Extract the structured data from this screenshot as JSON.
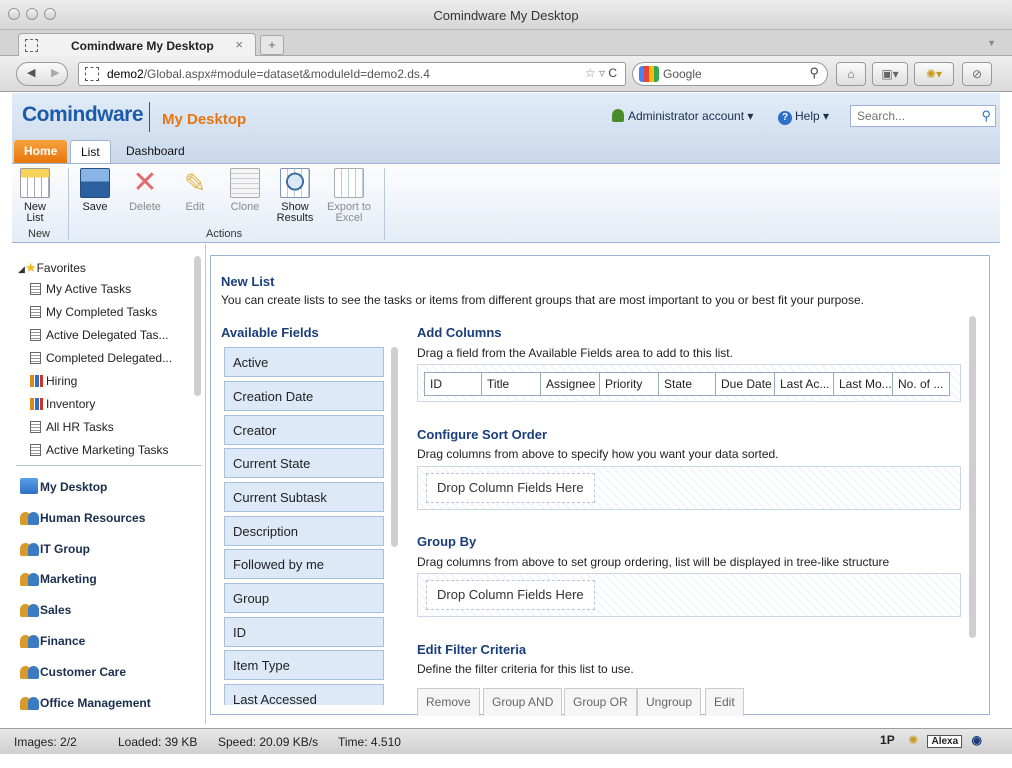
{
  "window": {
    "title": "Comindware My Desktop"
  },
  "browser": {
    "tab_title": "Comindware My Desktop",
    "tab_close": "×",
    "new_tab": "+",
    "url_host": "demo2",
    "url_path": "/Global.aspx#module=dataset&moduleId=demo2.ds.4",
    "search_engine": "Google",
    "icons": [
      "back-icon",
      "forward-icon",
      "bookmark-star-icon",
      "reload-icon",
      "home-icon",
      "search-icon"
    ]
  },
  "app": {
    "logo": "Comindware",
    "title": "My Desktop",
    "user": "Administrator account",
    "help": "Help",
    "search_placeholder": "Search..."
  },
  "ribbon_tabs": [
    "Home",
    "List",
    "Dashboard"
  ],
  "ribbon": {
    "new": {
      "label1": "New",
      "label2": "List"
    },
    "save": "Save",
    "delete": "Delete",
    "edit": "Edit",
    "clone": "Clone",
    "show": {
      "label1": "Show",
      "label2": "Results"
    },
    "export": {
      "label1": "Export to",
      "label2": "Excel"
    },
    "group_new": "New",
    "group_actions": "Actions"
  },
  "leftnav": {
    "favorites": "Favorites",
    "items": [
      "My Active Tasks",
      "My Completed Tasks",
      "Active Delegated Tas...",
      "Completed Delegated...",
      "Hiring",
      "Inventory",
      "All HR Tasks",
      "Active Marketing Tasks"
    ],
    "modules": [
      "My Desktop",
      "Human Resources",
      "IT Group",
      "Marketing",
      "Sales",
      "Finance",
      "Customer Care",
      "Office Management"
    ]
  },
  "main": {
    "title": "New List",
    "description": "You can create lists to see the tasks or items from different groups that are most important to you or best fit your purpose.",
    "available_fields_title": "Available Fields",
    "available_fields": [
      "Active",
      "Creation Date",
      "Creator",
      "Current State",
      "Current Subtask",
      "Description",
      "Followed by me",
      "Group",
      "ID",
      "Item Type",
      "Last Accessed"
    ],
    "add_columns": {
      "title": "Add Columns",
      "desc": "Drag a field from the Available Fields area to add to this list.",
      "columns": [
        "ID",
        "Title",
        "Assignee",
        "Priority",
        "State",
        "Due Date",
        "Last Ac...",
        "Last Mo...",
        "No. of ..."
      ]
    },
    "sort": {
      "title": "Configure Sort Order",
      "desc": "Drag columns from above to specify how you want your data sorted.",
      "drop": "Drop Column Fields Here"
    },
    "group": {
      "title": "Group By",
      "desc": "Drag columns from above to set group ordering, list will be displayed in tree-like structure",
      "drop": "Drop Column Fields Here"
    },
    "filter": {
      "title": "Edit Filter Criteria",
      "desc": "Define the filter criteria for this list to use.",
      "buttons": [
        "Remove",
        "Group AND",
        "Group OR",
        "Ungroup",
        "Edit"
      ]
    }
  },
  "status": {
    "images": "Images: 2/2",
    "loaded": "Loaded: 39 KB",
    "speed": "Speed: 20.09 KB/s",
    "time": "Time: 4.510",
    "onepassword": "1P",
    "alexa": "Alexa"
  },
  "colors": {
    "brand_blue": "#1d5aa8",
    "brand_orange": "#e67512",
    "field_bg": "#dde9f7"
  }
}
